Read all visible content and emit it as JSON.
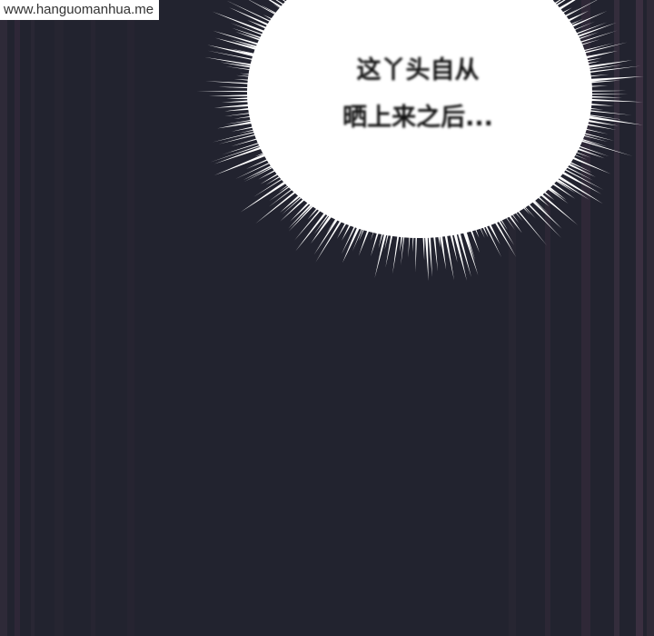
{
  "watermark": {
    "text": "www.hanguomanhua.me"
  },
  "dialogue": {
    "line1": "这丫头自从",
    "line2": "晒上来之后..."
  },
  "colors": {
    "background": "#22232f",
    "stripe_light": "#3a3040",
    "burst": "#ffffff",
    "text": "#111111"
  }
}
